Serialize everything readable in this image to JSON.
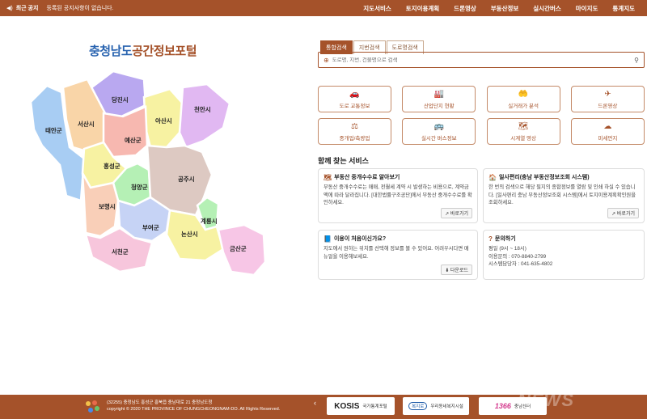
{
  "notice": {
    "label": "최근 공지",
    "text": "등록된 공지사항이 없습니다."
  },
  "nav": [
    "지도서비스",
    "토지이용계획",
    "드론영상",
    "부동산정보",
    "실시간버스",
    "마이지도",
    "통계지도"
  ],
  "portal": {
    "title_blue": "충청남도",
    "title_brown": "공간정보포털"
  },
  "map": {
    "regions": [
      {
        "name": "당진시",
        "color": "#b9a8f0"
      },
      {
        "name": "서산시",
        "color": "#f9d5a8"
      },
      {
        "name": "태안군",
        "color": "#a8cdf3"
      },
      {
        "name": "아산시",
        "color": "#f7f2a2"
      },
      {
        "name": "천안시",
        "color": "#e1b8f2"
      },
      {
        "name": "예산군",
        "color": "#f7b8b0"
      },
      {
        "name": "홍성군",
        "color": "#f7f2a2"
      },
      {
        "name": "청양군",
        "color": "#b5f0b5"
      },
      {
        "name": "공주시",
        "color": "#ddc9c2"
      },
      {
        "name": "보령시",
        "color": "#f9cfb8"
      },
      {
        "name": "부여군",
        "color": "#c6d3f5"
      },
      {
        "name": "계룡시",
        "color": "#b5f0b5"
      },
      {
        "name": "논산시",
        "color": "#f7f2a2"
      },
      {
        "name": "서천군",
        "color": "#f7c6dc"
      },
      {
        "name": "금산군",
        "color": "#f7c6e6"
      }
    ]
  },
  "search": {
    "tabs": [
      "통합검색",
      "지번검색",
      "도로명검색"
    ],
    "placeholder": "도로명, 지번, 건물명으로 검색",
    "pin_icon": "location-pin-icon",
    "search_icon": "magnifier-icon"
  },
  "quick": [
    {
      "label": "도로 교통정보",
      "icon": "🚗"
    },
    {
      "label": "산업단지 현황",
      "icon": "🏭"
    },
    {
      "label": "실거래가 분석",
      "icon": "🤲"
    },
    {
      "label": "드론영상",
      "icon": "✈"
    },
    {
      "label": "중개업/측량업",
      "icon": "⚖"
    },
    {
      "label": "실시간 버스정보",
      "icon": "🚌"
    },
    {
      "label": "시계열 영상",
      "icon": "🗺"
    },
    {
      "label": "미세먼지",
      "icon": "☁"
    }
  ],
  "services": {
    "title": "함께 찾는 서비스",
    "cards": [
      {
        "icon": "🗺",
        "title": "부동산 중개수수료 알아보기",
        "body": "부동산 중개수수료는 매매, 전월세 계약 시 발생하는 비용으로, 계약금액에 따라 달라집니다. [대한법률구조공단]에서 부동산 중개수수료를 확인하세요.",
        "button": "바로가기"
      },
      {
        "icon": "🏠",
        "title": "일사편리(충남 부동산정보조회 시스템)",
        "body": "한 번의 검색으로 해당 필지의 종합정보를 열람 및 인쇄 하실 수 있습니다. [일사편리 충남 부동산정보조회 시스템]에서 토지이용계획확인원을 조회하세요.",
        "button": "바로가기"
      },
      {
        "icon": "📘",
        "title": "이용이 처음이신가요?",
        "body": "지도에서 원하는 위치를 선택해 정보를 볼 수 있어요. 어려우시다면 매뉴얼을 이용해보세요.",
        "button": "다운로드"
      },
      {
        "icon": "?",
        "title": "문의하기",
        "lines": [
          "평일 (9시 ~ 18시)",
          "이용문의 : 070-8840-2799",
          "시스템담당자 : 041-635-4802"
        ]
      }
    ]
  },
  "footer": {
    "address": "(32255) 충청남도 홍성군 홍북읍 충남대로 21 충청남도청",
    "copyright": "copyright © 2020 THE PROVINCE OF CHUNGCHEONGNAM-DO. All Rights Reserved.",
    "banners": [
      {
        "main": "KOSIS",
        "sub": "국가통계포털"
      },
      {
        "badge": "복지로",
        "sub": "우리동네복지시설"
      },
      {
        "num": "1366",
        "sub": "충남센터"
      }
    ],
    "watermark": "NEWS"
  },
  "colors": {
    "brand": "#a5522a",
    "title_blue": "#2a64b0"
  }
}
